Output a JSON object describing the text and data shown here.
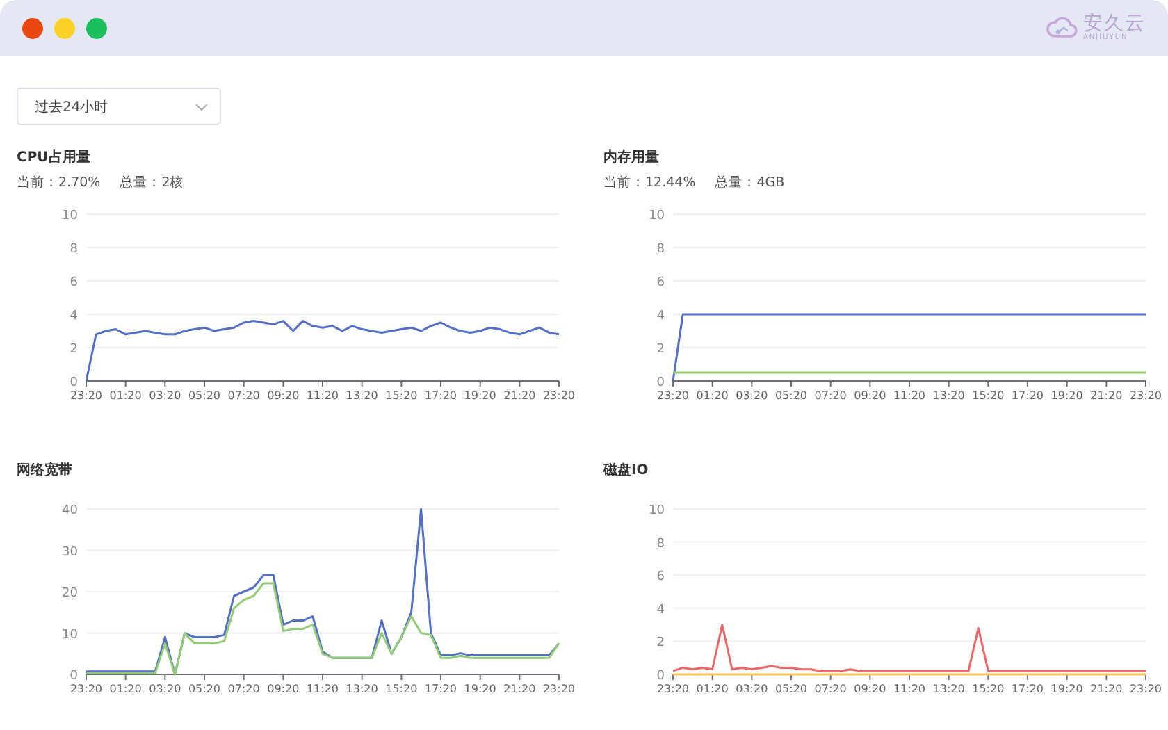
{
  "window": {
    "logo": {
      "name": "安久云",
      "subtitle": "ANJIUYUN"
    }
  },
  "range_select": {
    "value": "过去24小时"
  },
  "panels": [
    {
      "title": "CPU占用量",
      "stats": [
        "当前：2.70%",
        "总量：2核"
      ],
      "chart_data": {
        "type": "line",
        "grid": true,
        "ylim": [
          0,
          10
        ],
        "yticks": [
          0,
          2,
          4,
          6,
          8,
          10
        ],
        "categories": [
          "23:20",
          null,
          null,
          null,
          "01:20",
          null,
          null,
          null,
          "03:20",
          null,
          null,
          null,
          "05:20",
          null,
          null,
          null,
          "07:20",
          null,
          null,
          null,
          "09:20",
          null,
          null,
          null,
          "11:20",
          null,
          null,
          null,
          "13:20",
          null,
          null,
          null,
          "15:20",
          null,
          null,
          null,
          "17:20",
          null,
          null,
          null,
          "19:20",
          null,
          null,
          null,
          "21:20",
          null,
          null,
          null,
          "23:20"
        ],
        "series": [
          {
            "color": "#5470c6",
            "values": [
              0,
              2.8,
              3.0,
              3.1,
              2.8,
              2.9,
              3.0,
              2.9,
              2.8,
              2.8,
              3.0,
              3.1,
              3.2,
              3.0,
              3.1,
              3.2,
              3.5,
              3.6,
              3.5,
              3.4,
              3.6,
              3.0,
              3.6,
              3.3,
              3.2,
              3.3,
              3.0,
              3.3,
              3.1,
              3.0,
              2.9,
              3.0,
              3.1,
              3.2,
              3.0,
              3.3,
              3.5,
              3.2,
              3.0,
              2.9,
              3.0,
              3.2,
              3.1,
              2.9,
              2.8,
              3.0,
              3.2,
              2.9,
              2.8
            ]
          }
        ]
      }
    },
    {
      "title": "内存用量",
      "stats": [
        "当前：12.44%",
        "总量：4GB"
      ],
      "chart_data": {
        "type": "line",
        "grid": true,
        "ylim": [
          0,
          10
        ],
        "yticks": [
          0,
          2,
          4,
          6,
          8,
          10
        ],
        "categories": [
          "23:20",
          null,
          null,
          null,
          "01:20",
          null,
          null,
          null,
          "03:20",
          null,
          null,
          null,
          "05:20",
          null,
          null,
          null,
          "07:20",
          null,
          null,
          null,
          "09:20",
          null,
          null,
          null,
          "11:20",
          null,
          null,
          null,
          "13:20",
          null,
          null,
          null,
          "15:20",
          null,
          null,
          null,
          "17:20",
          null,
          null,
          null,
          "19:20",
          null,
          null,
          null,
          "21:20",
          null,
          null,
          null,
          "23:20"
        ],
        "series": [
          {
            "color": "#5470c6",
            "values": [
              0,
              4,
              4,
              4,
              4,
              4,
              4,
              4,
              4,
              4,
              4,
              4,
              4,
              4,
              4,
              4,
              4,
              4,
              4,
              4,
              4,
              4,
              4,
              4,
              4,
              4,
              4,
              4,
              4,
              4,
              4,
              4,
              4,
              4,
              4,
              4,
              4,
              4,
              4,
              4,
              4,
              4,
              4,
              4,
              4,
              4,
              4,
              4,
              4
            ]
          },
          {
            "color": "#91cc75",
            "values": [
              0.5,
              0.5,
              0.5,
              0.5,
              0.5,
              0.5,
              0.5,
              0.5,
              0.5,
              0.5,
              0.5,
              0.5,
              0.5,
              0.5,
              0.5,
              0.5,
              0.5,
              0.5,
              0.5,
              0.5,
              0.5,
              0.5,
              0.5,
              0.5,
              0.5,
              0.5,
              0.5,
              0.5,
              0.5,
              0.5,
              0.5,
              0.5,
              0.5,
              0.5,
              0.5,
              0.5,
              0.5,
              0.5,
              0.5,
              0.5,
              0.5,
              0.5,
              0.5,
              0.5,
              0.5,
              0.5,
              0.5,
              0.5,
              0.5
            ]
          }
        ]
      }
    },
    {
      "title": "网络宽带",
      "chart_data": {
        "type": "line",
        "grid": true,
        "ylim": [
          0,
          40
        ],
        "yticks": [
          0,
          10,
          20,
          30,
          40
        ],
        "categories": [
          "23:20",
          null,
          null,
          null,
          "01:20",
          null,
          null,
          null,
          "03:20",
          null,
          null,
          null,
          "05:20",
          null,
          null,
          null,
          "07:20",
          null,
          null,
          null,
          "09:20",
          null,
          null,
          null,
          "11:20",
          null,
          null,
          null,
          "13:20",
          null,
          null,
          null,
          "15:20",
          null,
          null,
          null,
          "17:20",
          null,
          null,
          null,
          "19:20",
          null,
          null,
          null,
          "21:20",
          null,
          null,
          null,
          "23:20"
        ],
        "series": [
          {
            "color": "#5470c6",
            "values": [
              0.7,
              0.7,
              0.7,
              0.7,
              0.7,
              0.7,
              0.7,
              0.7,
              9,
              0,
              10,
              9,
              9,
              9,
              9.5,
              19,
              20,
              21,
              24,
              24,
              12,
              13,
              13,
              14,
              5.5,
              4,
              4,
              4,
              4,
              4,
              13,
              5,
              9,
              15,
              40,
              10,
              4.6,
              4.6,
              5.1,
              4.6,
              4.6,
              4.6,
              4.6,
              4.6,
              4.6,
              4.6,
              4.6,
              4.6,
              7.5
            ]
          },
          {
            "color": "#91cc75",
            "values": [
              0.3,
              0.3,
              0.3,
              0.3,
              0.3,
              0.3,
              0.3,
              0.3,
              7.5,
              0,
              10,
              7.5,
              7.5,
              7.5,
              8,
              16,
              18,
              19,
              22,
              22,
              10.5,
              11,
              11,
              12,
              5,
              4,
              4,
              4,
              4,
              4,
              10,
              5,
              9,
              14,
              10,
              9.5,
              4,
              4,
              4.5,
              4,
              4,
              4,
              4,
              4,
              4,
              4,
              4,
              4,
              7.5
            ]
          }
        ]
      }
    },
    {
      "title": "磁盘IO",
      "chart_data": {
        "type": "line",
        "grid": true,
        "ylim": [
          0,
          10
        ],
        "yticks": [
          0,
          2,
          4,
          6,
          8,
          10
        ],
        "categories": [
          "23:20",
          null,
          null,
          null,
          "01:20",
          null,
          null,
          null,
          "03:20",
          null,
          null,
          null,
          "05:20",
          null,
          null,
          null,
          "07:20",
          null,
          null,
          null,
          "09:20",
          null,
          null,
          null,
          "11:20",
          null,
          null,
          null,
          "13:20",
          null,
          null,
          null,
          "15:20",
          null,
          null,
          null,
          "17:20",
          null,
          null,
          null,
          "19:20",
          null,
          null,
          null,
          "21:20",
          null,
          null,
          null,
          "23:20"
        ],
        "series": [
          {
            "color": "#fac858",
            "values": [
              0,
              0,
              0,
              0,
              0,
              0,
              0,
              0,
              0,
              0,
              0,
              0,
              0,
              0,
              0,
              0,
              0,
              0,
              0,
              0,
              0,
              0,
              0,
              0,
              0,
              0,
              0,
              0,
              0,
              0,
              0,
              0,
              0,
              0,
              0,
              0,
              0,
              0,
              0,
              0,
              0,
              0,
              0,
              0,
              0,
              0,
              0,
              0,
              0
            ]
          },
          {
            "color": "#ee6666",
            "values": [
              0.2,
              0.4,
              0.3,
              0.4,
              0.3,
              3,
              0.3,
              0.4,
              0.3,
              0.4,
              0.5,
              0.4,
              0.4,
              0.3,
              0.3,
              0.2,
              0.2,
              0.2,
              0.3,
              0.2,
              0.2,
              0.2,
              0.2,
              0.2,
              0.2,
              0.2,
              0.2,
              0.2,
              0.2,
              0.2,
              0.2,
              2.8,
              0.2,
              0.2,
              0.2,
              0.2,
              0.2,
              0.2,
              0.2,
              0.2,
              0.2,
              0.2,
              0.2,
              0.2,
              0.2,
              0.2,
              0.2,
              0.2,
              0.2
            ]
          }
        ]
      }
    }
  ]
}
